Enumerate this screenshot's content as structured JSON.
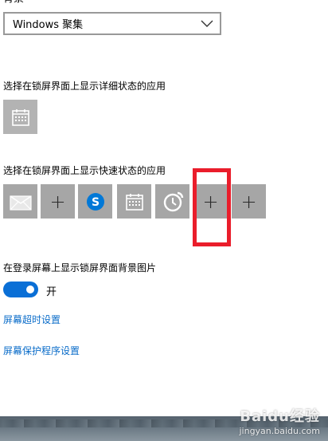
{
  "heading_cut": "背景",
  "background_dropdown": {
    "value": "Windows 聚集"
  },
  "detailed_status": {
    "label": "选择在锁屏界面上显示详细状态的应用",
    "app_icon": "calendar-icon"
  },
  "quick_status": {
    "label": "选择在锁屏界面上显示快速状态的应用",
    "tiles": [
      {
        "icon": "mail-icon"
      },
      {
        "icon": "plus-icon",
        "text": "+"
      },
      {
        "icon": "skype-icon"
      },
      {
        "icon": "calendar-icon"
      },
      {
        "icon": "alarm-clock-icon"
      },
      {
        "icon": "plus-icon",
        "text": "+"
      },
      {
        "icon": "plus-icon",
        "text": "+"
      }
    ]
  },
  "signin_background": {
    "label": "在登录屏幕上显示锁屏界面背景图片",
    "toggle_state": "开",
    "is_on": true
  },
  "links": {
    "screen_timeout": "屏幕超时设置",
    "screensaver": "屏幕保护程序设置"
  },
  "watermark": {
    "main": "Baidu经验",
    "sub": "jingyan.baidu.com"
  },
  "colors": {
    "accent": "#0a6fd6",
    "link": "#0a6cc9",
    "tile": "#a6a6a6",
    "highlight": "#ea1d2b"
  }
}
